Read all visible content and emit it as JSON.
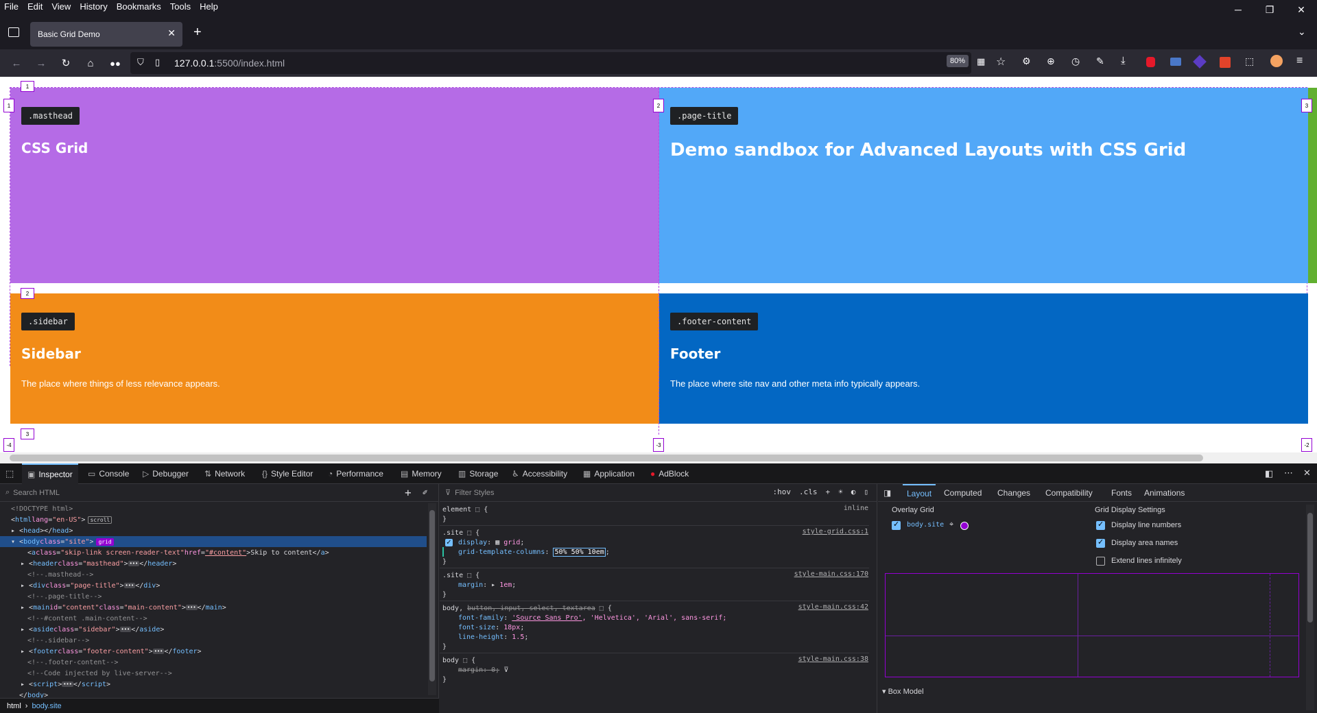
{
  "menu": [
    "File",
    "Edit",
    "View",
    "History",
    "Bookmarks",
    "Tools",
    "Help"
  ],
  "tab": {
    "title": "Basic Grid Demo"
  },
  "nav": {
    "url_host": "127.0.0.1",
    "url_rest": ":5500/index.html",
    "zoom": "80%"
  },
  "page": {
    "masthead": {
      "tag": ".masthead",
      "heading": "CSS Grid",
      "color": "#b56be6"
    },
    "page_title": {
      "tag": ".page-title",
      "heading": "Demo sandbox for Advanced Layouts with CSS Grid",
      "color": "#52a8f8"
    },
    "sidebar": {
      "tag": ".sidebar",
      "heading": "Sidebar",
      "text": "The place where things of less relevance appears.",
      "color": "#f28c18"
    },
    "footer": {
      "tag": ".footer-content",
      "heading": "Footer",
      "text": "The place where site nav and other meta info typically appears.",
      "color": "#0367c3"
    },
    "grid_labels": {
      "row1": "1",
      "row2": "2",
      "row3": "3",
      "col1": "1",
      "col2": "2",
      "col3": "3",
      "neg_col1": "-4",
      "neg_col2": "-3",
      "neg_col3": "-2"
    }
  },
  "devtools": {
    "tabs": [
      "Inspector",
      "Console",
      "Debugger",
      "Network",
      "Style Editor",
      "Performance",
      "Memory",
      "Storage",
      "Accessibility",
      "Application",
      "AdBlock"
    ],
    "html_search_placeholder": "Search HTML",
    "tree": {
      "doctype": "<!DOCTYPE html>",
      "html_open": "html",
      "html_lang_attr": "lang",
      "html_lang_val": "\"en-US\"",
      "scroll_badge": "scroll",
      "head": "head",
      "body_tag": "body",
      "body_class_attr": "class",
      "body_class_val": "\"site\"",
      "grid_badge": "grid",
      "a_tag": "a",
      "a_attr1": "class",
      "a_val1": "\"skip-link screen-reader-text\"",
      "a_attr2": "href",
      "a_val2": "\"#content\"",
      "a_text": "Skip to content",
      "header_tag": "header",
      "header_val": "\"masthead\"",
      "c1": "<!--.masthead-->",
      "div_tag": "div",
      "div_val": "\"page-title\"",
      "c2": "<!--.page-title-->",
      "main_tag": "main",
      "main_attr1": "id",
      "main_val1": "\"content\"",
      "main_val2": "\"main-content\"",
      "c3": "<!--#content .main-content-->",
      "aside_tag": "aside",
      "aside_val": "\"sidebar\"",
      "c4": "<!--.sidebar-->",
      "footer_tag": "footer",
      "footer_val": "\"footer-content\"",
      "c5": "<!--.footer-content-->",
      "c6": "<!--Code injected by live-server-->",
      "script_tag": "script",
      "body_close": "body"
    },
    "breadcrumbs": [
      "html",
      "body.site"
    ],
    "rules": {
      "filter_placeholder": "Filter Styles",
      "tools": [
        ":hov",
        ".cls"
      ],
      "element_sel": "element",
      "inline": "inline",
      "site_sel": ".site",
      "src1": "style-grid.css:1",
      "display_prop": "display",
      "display_val": "grid",
      "gtc_prop": "grid-template-columns",
      "gtc_val": "50% 50% 10em",
      "src2": "style-main.css:170",
      "margin_prop": "margin",
      "margin_val": "1em",
      "body_sel_a": "body,",
      "body_sel_b": "button, input, select, textarea",
      "src3": "style-main.css:42",
      "ff_prop": "font-family",
      "ff_val_link": "'Source Sans Pro'",
      "ff_val_rest": ", 'Helvetica', 'Arial', sans-serif;",
      "fs_prop": "font-size",
      "fs_val": "18px",
      "lh_prop": "line-height",
      "lh_val": "1.5",
      "body_sel": "body",
      "src4": "style-main.css:38",
      "margin0": "margin: 0;"
    },
    "layout": {
      "tabs": [
        "Layout",
        "Computed",
        "Changes",
        "Compatibility",
        "Fonts",
        "Animations"
      ],
      "overlay_grid": "Overlay Grid",
      "grid_item": "body.site",
      "display_settings": "Grid Display Settings",
      "opt1": "Display line numbers",
      "opt2": "Display area names",
      "opt3": "Extend lines infinitely",
      "box_model": "Box Model"
    }
  }
}
